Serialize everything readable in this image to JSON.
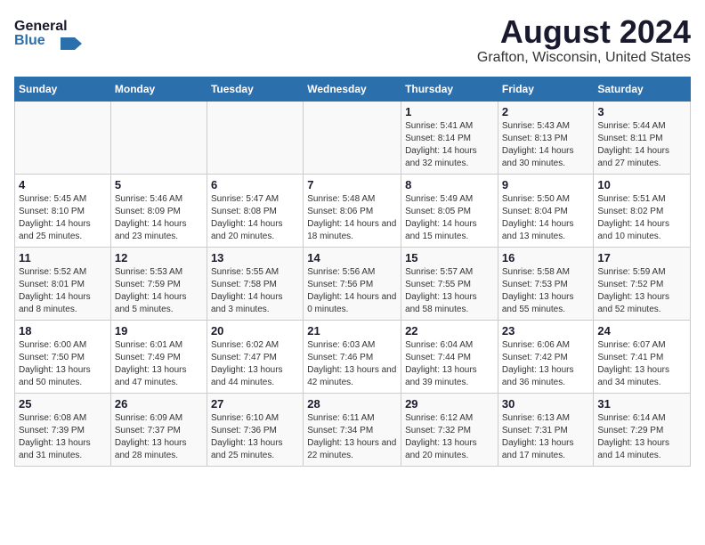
{
  "header": {
    "logo_general": "General",
    "logo_blue": "Blue",
    "title": "August 2024",
    "subtitle": "Grafton, Wisconsin, United States"
  },
  "calendar": {
    "days_of_week": [
      "Sunday",
      "Monday",
      "Tuesday",
      "Wednesday",
      "Thursday",
      "Friday",
      "Saturday"
    ],
    "weeks": [
      {
        "days": [
          {
            "number": "",
            "info": ""
          },
          {
            "number": "",
            "info": ""
          },
          {
            "number": "",
            "info": ""
          },
          {
            "number": "",
            "info": ""
          },
          {
            "number": "1",
            "info": "Sunrise: 5:41 AM\nSunset: 8:14 PM\nDaylight: 14 hours\nand 32 minutes."
          },
          {
            "number": "2",
            "info": "Sunrise: 5:43 AM\nSunset: 8:13 PM\nDaylight: 14 hours\nand 30 minutes."
          },
          {
            "number": "3",
            "info": "Sunrise: 5:44 AM\nSunset: 8:11 PM\nDaylight: 14 hours\nand 27 minutes."
          }
        ]
      },
      {
        "days": [
          {
            "number": "4",
            "info": "Sunrise: 5:45 AM\nSunset: 8:10 PM\nDaylight: 14 hours\nand 25 minutes."
          },
          {
            "number": "5",
            "info": "Sunrise: 5:46 AM\nSunset: 8:09 PM\nDaylight: 14 hours\nand 23 minutes."
          },
          {
            "number": "6",
            "info": "Sunrise: 5:47 AM\nSunset: 8:08 PM\nDaylight: 14 hours\nand 20 minutes."
          },
          {
            "number": "7",
            "info": "Sunrise: 5:48 AM\nSunset: 8:06 PM\nDaylight: 14 hours\nand 18 minutes."
          },
          {
            "number": "8",
            "info": "Sunrise: 5:49 AM\nSunset: 8:05 PM\nDaylight: 14 hours\nand 15 minutes."
          },
          {
            "number": "9",
            "info": "Sunrise: 5:50 AM\nSunset: 8:04 PM\nDaylight: 14 hours\nand 13 minutes."
          },
          {
            "number": "10",
            "info": "Sunrise: 5:51 AM\nSunset: 8:02 PM\nDaylight: 14 hours\nand 10 minutes."
          }
        ]
      },
      {
        "days": [
          {
            "number": "11",
            "info": "Sunrise: 5:52 AM\nSunset: 8:01 PM\nDaylight: 14 hours\nand 8 minutes."
          },
          {
            "number": "12",
            "info": "Sunrise: 5:53 AM\nSunset: 7:59 PM\nDaylight: 14 hours\nand 5 minutes."
          },
          {
            "number": "13",
            "info": "Sunrise: 5:55 AM\nSunset: 7:58 PM\nDaylight: 14 hours\nand 3 minutes."
          },
          {
            "number": "14",
            "info": "Sunrise: 5:56 AM\nSunset: 7:56 PM\nDaylight: 14 hours\nand 0 minutes."
          },
          {
            "number": "15",
            "info": "Sunrise: 5:57 AM\nSunset: 7:55 PM\nDaylight: 13 hours\nand 58 minutes."
          },
          {
            "number": "16",
            "info": "Sunrise: 5:58 AM\nSunset: 7:53 PM\nDaylight: 13 hours\nand 55 minutes."
          },
          {
            "number": "17",
            "info": "Sunrise: 5:59 AM\nSunset: 7:52 PM\nDaylight: 13 hours\nand 52 minutes."
          }
        ]
      },
      {
        "days": [
          {
            "number": "18",
            "info": "Sunrise: 6:00 AM\nSunset: 7:50 PM\nDaylight: 13 hours\nand 50 minutes."
          },
          {
            "number": "19",
            "info": "Sunrise: 6:01 AM\nSunset: 7:49 PM\nDaylight: 13 hours\nand 47 minutes."
          },
          {
            "number": "20",
            "info": "Sunrise: 6:02 AM\nSunset: 7:47 PM\nDaylight: 13 hours\nand 44 minutes."
          },
          {
            "number": "21",
            "info": "Sunrise: 6:03 AM\nSunset: 7:46 PM\nDaylight: 13 hours\nand 42 minutes."
          },
          {
            "number": "22",
            "info": "Sunrise: 6:04 AM\nSunset: 7:44 PM\nDaylight: 13 hours\nand 39 minutes."
          },
          {
            "number": "23",
            "info": "Sunrise: 6:06 AM\nSunset: 7:42 PM\nDaylight: 13 hours\nand 36 minutes."
          },
          {
            "number": "24",
            "info": "Sunrise: 6:07 AM\nSunset: 7:41 PM\nDaylight: 13 hours\nand 34 minutes."
          }
        ]
      },
      {
        "days": [
          {
            "number": "25",
            "info": "Sunrise: 6:08 AM\nSunset: 7:39 PM\nDaylight: 13 hours\nand 31 minutes."
          },
          {
            "number": "26",
            "info": "Sunrise: 6:09 AM\nSunset: 7:37 PM\nDaylight: 13 hours\nand 28 minutes."
          },
          {
            "number": "27",
            "info": "Sunrise: 6:10 AM\nSunset: 7:36 PM\nDaylight: 13 hours\nand 25 minutes."
          },
          {
            "number": "28",
            "info": "Sunrise: 6:11 AM\nSunset: 7:34 PM\nDaylight: 13 hours\nand 22 minutes."
          },
          {
            "number": "29",
            "info": "Sunrise: 6:12 AM\nSunset: 7:32 PM\nDaylight: 13 hours\nand 20 minutes."
          },
          {
            "number": "30",
            "info": "Sunrise: 6:13 AM\nSunset: 7:31 PM\nDaylight: 13 hours\nand 17 minutes."
          },
          {
            "number": "31",
            "info": "Sunrise: 6:14 AM\nSunset: 7:29 PM\nDaylight: 13 hours\nand 14 minutes."
          }
        ]
      }
    ]
  }
}
